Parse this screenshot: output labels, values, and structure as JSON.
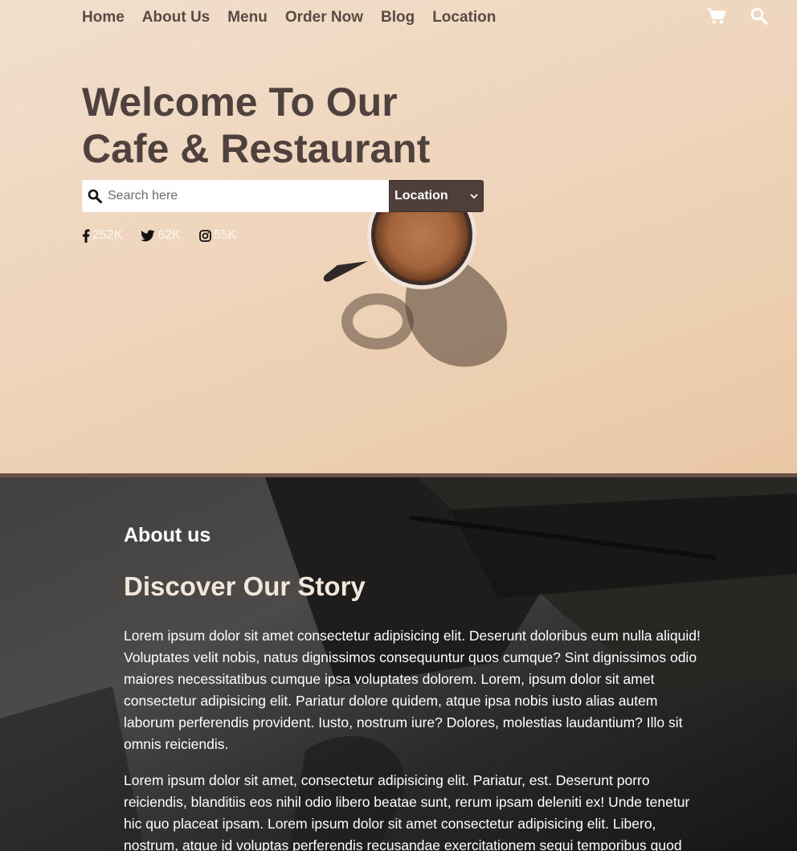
{
  "nav": {
    "items": [
      "Home",
      "About Us",
      "Menu",
      "Order Now",
      "Blog",
      "Location"
    ],
    "icons": [
      "cart-icon",
      "search-icon"
    ]
  },
  "hero": {
    "title_line1": "Welcome To Our",
    "title_line2": "Cafe & Restaurant",
    "search": {
      "placeholder": "Search here",
      "location_selected": "Location"
    },
    "socials": [
      {
        "icon": "facebook-icon",
        "count": "252K"
      },
      {
        "icon": "twitter-icon",
        "count": "62K"
      },
      {
        "icon": "instagram-icon",
        "count": "55K"
      }
    ]
  },
  "about": {
    "label": "About us",
    "heading": "Discover Our Story",
    "paragraph1": "Lorem ipsum dolor sit amet consectetur adipisicing elit. Deserunt doloribus eum nulla aliquid! Voluptates velit nobis, natus dignissimos consequuntur quos cumque? Sint dignissimos odio maiores necessitatibus cumque ipsa voluptates dolorem. Lorem, ipsum dolor sit amet consectetur adipisicing elit. Pariatur dolore quidem, atque ipsa nobis iusto alias autem laborum perferendis provident. Iusto, nostrum iure? Dolores, molestias laudantium? Illo sit omnis reiciendis.",
    "paragraph2": "Lorem ipsum dolor sit amet, consectetur adipisicing elit. Pariatur, est. Deserunt porro reiciendis, blanditiis eos nihil odio libero beatae sunt, rerum ipsam deleniti ex! Unde tenetur hic quo placeat ipsam. Lorem ipsum dolor sit amet consectetur adipisicing elit. Libero, nostrum, atque id voluptas perferendis recusandae exercitationem sequi temporibus quod"
  },
  "colors": {
    "hero_bg": "#efd6bd",
    "nav_text": "#5a4a44",
    "title_text": "#4f413d",
    "select_bg": "#4f3f3a",
    "divider": "#6a5149"
  }
}
